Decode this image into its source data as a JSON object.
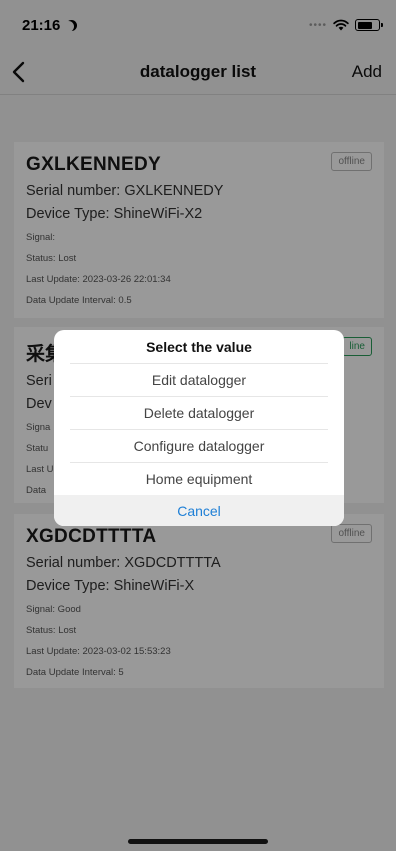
{
  "status_bar": {
    "time": "21:16",
    "icons": [
      "moon-icon",
      "cellular-dots-icon",
      "wifi-icon",
      "battery-icon"
    ],
    "battery_level": 0.7
  },
  "navbar": {
    "title": "datalogger list",
    "add_label": "Add",
    "back_icon": "chevron-left-icon"
  },
  "devices": [
    {
      "name": "GXLKENNEDY",
      "status_badge": "offline",
      "serial": "Serial number: GXLKENNEDY",
      "device_type": "Device Type: ShineWiFi-X2",
      "signal": "Signal:",
      "status": "Status: Lost",
      "last_update": "Last Update: 2023-03-26 22:01:34",
      "interval": "Data Update Interval: 0.5"
    },
    {
      "name": "采集",
      "status_badge": "line",
      "serial": "Seri",
      "device_type": "Dev",
      "signal": "Signa",
      "status": "Statu",
      "last_update": "Last U",
      "interval": "Data"
    },
    {
      "name": "XGDCDTTTTA",
      "status_badge": "offline",
      "serial": "Serial number: XGDCDTTTTA",
      "device_type": "Device Type: ShineWiFi-X",
      "signal": "Signal: Good",
      "status": "Status: Lost",
      "last_update": "Last Update: 2023-03-02 15:53:23",
      "interval": "Data Update Interval: 5"
    }
  ],
  "dialog": {
    "title": "Select the value",
    "options": [
      "Edit datalogger",
      "Delete datalogger",
      "Configure datalogger",
      "Home equipment"
    ],
    "cancel_label": "Cancel"
  },
  "colors": {
    "background": "#f2f2f2",
    "accent_blue": "#1e7fd6",
    "online_green": "#2a9d5b",
    "overlay": "rgba(0,0,0,0.40)"
  }
}
